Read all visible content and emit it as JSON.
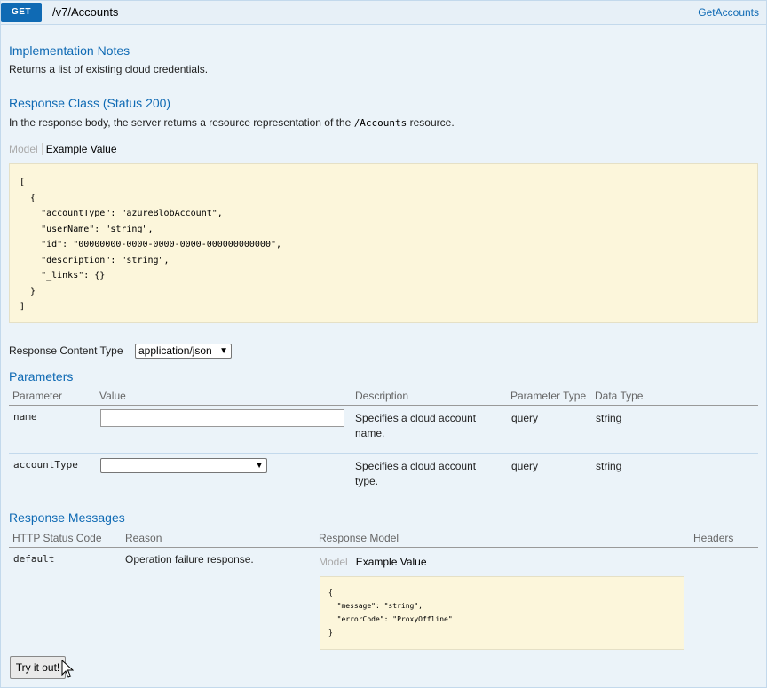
{
  "operation": {
    "method": "GET",
    "path": "/v7/Accounts",
    "nickname": "GetAccounts"
  },
  "implementation_notes": {
    "heading": "Implementation Notes",
    "text": "Returns a list of existing cloud credentials."
  },
  "response_class": {
    "heading": "Response Class (Status 200)",
    "text_before": "In the response body, the server returns a resource representation of the",
    "resource": "/Accounts",
    "text_after": "resource.",
    "tab_model": "Model",
    "tab_example": "Example Value",
    "example": "[\n  {\n    \"accountType\": \"azureBlobAccount\",\n    \"userName\": \"string\",\n    \"id\": \"00000000-0000-0000-0000-000000000000\",\n    \"description\": \"string\",\n    \"_links\": {}\n  }\n]"
  },
  "content_type": {
    "label": "Response Content Type",
    "selected": "application/json"
  },
  "parameters": {
    "heading": "Parameters",
    "columns": [
      "Parameter",
      "Value",
      "Description",
      "Parameter Type",
      "Data Type"
    ],
    "rows": [
      {
        "name": "name",
        "value": "",
        "description_line1": "Specifies a cloud account",
        "description_line2": "name.",
        "param_type": "query",
        "data_type": "string"
      },
      {
        "name": "accountType",
        "value": "",
        "description_line1": "Specifies a cloud account",
        "description_line2": "type.",
        "param_type": "query",
        "data_type": "string"
      }
    ]
  },
  "response_messages": {
    "heading": "Response Messages",
    "columns": [
      "HTTP Status Code",
      "Reason",
      "Response Model",
      "Headers"
    ],
    "rows": [
      {
        "code": "default",
        "reason": "Operation failure response.",
        "tab_model": "Model",
        "tab_example": "Example Value",
        "example": "{\n  \"message\": \"string\",\n  \"errorCode\": \"ProxyOffline\"\n}"
      }
    ]
  },
  "try_button": "Try it out!",
  "colors": {
    "accent": "#0f6ab4",
    "panel_bg": "#ebf3f9",
    "code_bg": "#fcf6db"
  }
}
